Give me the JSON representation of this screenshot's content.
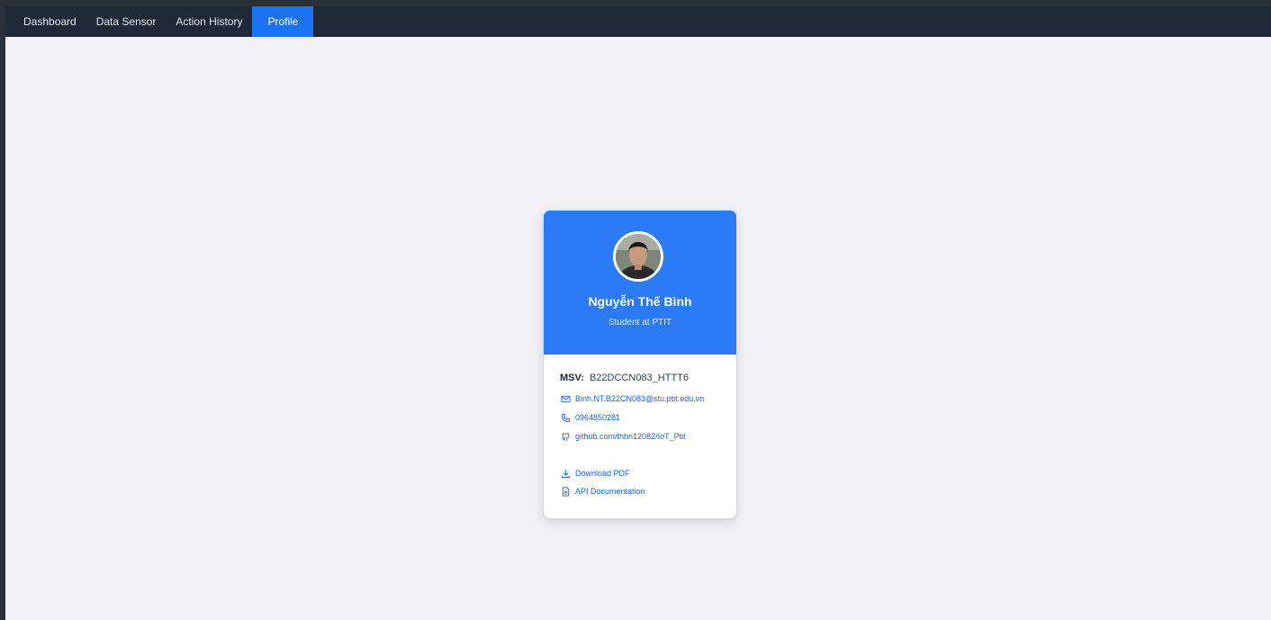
{
  "nav": {
    "items": [
      {
        "label": "Dashboard"
      },
      {
        "label": "Data Sensor"
      },
      {
        "label": "Action History"
      },
      {
        "label": "Profile",
        "active": true
      }
    ]
  },
  "profile": {
    "name": "Nguyễn Thế Bình",
    "role": "Student at PTIT",
    "msv_label": "MSV:",
    "msv_value": "B22DCCN083_HTTT6",
    "email": "Binh.NT.B22CN083@stu.ptit.edu.vn",
    "phone": "0964850281",
    "github": "github.com/thbn12082/IoT_Ptit",
    "download_label": "Download PDF",
    "api_label": "API Documentation"
  },
  "icons": {
    "email": "mail-icon",
    "phone": "phone-icon",
    "github": "github-icon",
    "download": "download-icon",
    "api": "document-icon"
  },
  "colors": {
    "navbar": "#1f2937",
    "nav_active": "#1a73f5",
    "card_header": "#2b7bf7",
    "page_bg": "#f0f0f5",
    "link": "#2463d6"
  }
}
